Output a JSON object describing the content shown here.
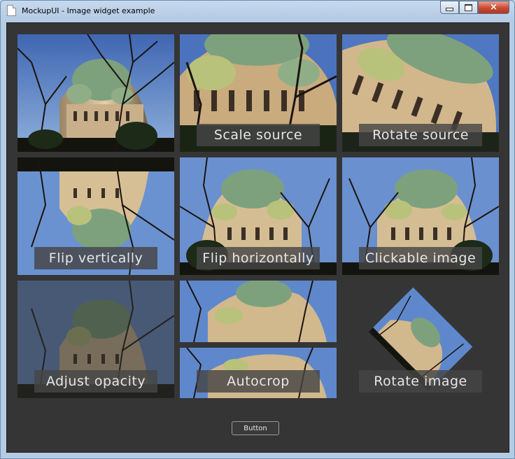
{
  "window": {
    "title": "MockupUI - Image widget example",
    "controls": {
      "minimize": "minimize",
      "maximize": "maximize",
      "close": "×"
    }
  },
  "tiles": [
    {
      "caption": "",
      "effect": "original"
    },
    {
      "caption": "Scale source",
      "effect": "scaled"
    },
    {
      "caption": "Rotate source",
      "effect": "rotated"
    },
    {
      "caption": "Flip vertically",
      "effect": "flip-vertical"
    },
    {
      "caption": "Flip horizontally",
      "effect": "flip-horizontal"
    },
    {
      "caption": "Clickable image",
      "effect": "normal"
    },
    {
      "caption": "Adjust opacity",
      "effect": "dimmed"
    },
    {
      "caption": "Autocrop",
      "effect": "split"
    },
    {
      "caption": "Rotate image",
      "effect": "rotated-diamond"
    }
  ],
  "button": {
    "label": "Button"
  },
  "colors": {
    "client_bg": "#353535",
    "caption_bg": "#464646",
    "sky": "#5a7fc0",
    "dome": "#7da17d"
  }
}
